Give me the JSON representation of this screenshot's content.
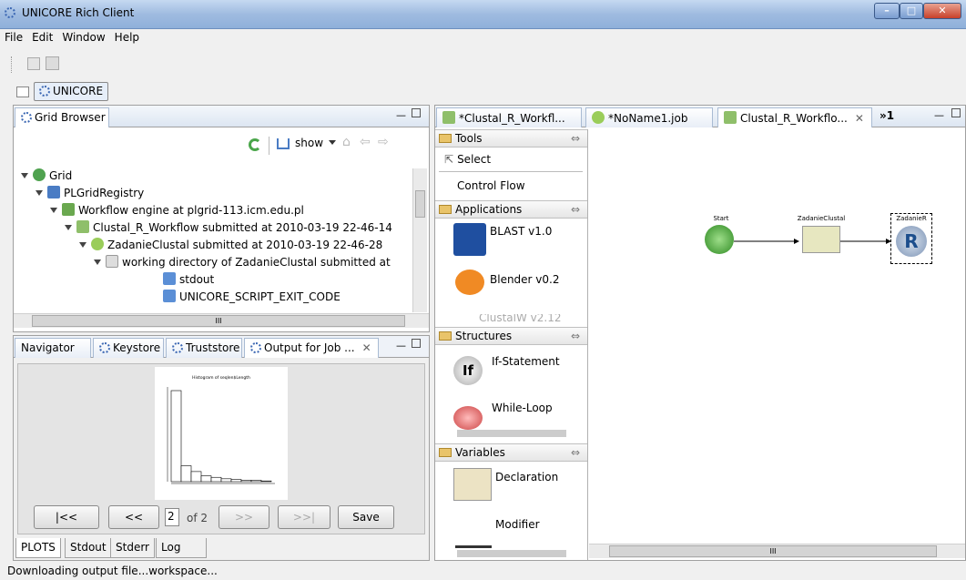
{
  "window": {
    "title": "UNICORE Rich Client"
  },
  "menu": [
    "File",
    "Edit",
    "Window",
    "Help"
  ],
  "perspective": {
    "label": "UNICORE"
  },
  "grid_browser": {
    "tab": "Grid Browser",
    "show_label": "show",
    "tree": [
      {
        "label": "Grid",
        "indent": 0,
        "icon": "globe-icon"
      },
      {
        "label": "PLGridRegistry",
        "indent": 1,
        "icon": "registry-icon"
      },
      {
        "label": "Workflow engine at plgrid-113.icm.edu.pl",
        "indent": 2,
        "icon": "workflow-engine-icon"
      },
      {
        "label": "Clustal_R_Workflow submitted at 2010-03-19 22-46-14",
        "indent": 3,
        "icon": "workflow-icon"
      },
      {
        "label": "ZadanieClustal submitted at 2010-03-19 22-46-28",
        "indent": 4,
        "icon": "job-icon"
      },
      {
        "label": "working directory of ZadanieClustal submitted at",
        "indent": 5,
        "icon": "folder-icon"
      },
      {
        "label": "stdout",
        "indent": 6,
        "icon": "file-icon"
      },
      {
        "label": "UNICORE_SCRIPT_EXIT_CODE",
        "indent": 6,
        "icon": "file-icon"
      }
    ],
    "hscroll_mark": "III"
  },
  "views": {
    "tabs": [
      "Navigator",
      "Keystore",
      "Truststore",
      "Output for Job ..."
    ]
  },
  "output": {
    "plot_title": "Histogram of seqlen$Length",
    "page_value": "2",
    "page_of": "of 2",
    "buttons": {
      "first": "|<<",
      "prev": "<<",
      "next": ">>",
      "last": ">>|",
      "save": "Save"
    },
    "bottom_tabs": [
      "PLOTS",
      "Stdout",
      "Stderr",
      "Log"
    ],
    "histogram": [
      6.3,
      1.1,
      0.7,
      0.4,
      0.3,
      0.2,
      0.15,
      0.1,
      0.1,
      0.05
    ]
  },
  "editor": {
    "tabs": [
      "*Clustal_R_Workfl...",
      "*NoName1.job",
      "Clustal_R_Workflo...",
      "»1"
    ]
  },
  "palette": {
    "tools": "Tools",
    "select": "Select",
    "control_flow": "Control Flow",
    "applications": "Applications",
    "apps": [
      "BLAST v1.0",
      "Blender v0.2",
      "ClustalW v2.12"
    ],
    "structures": "Structures",
    "structs": [
      "If-Statement",
      "While-Loop"
    ],
    "variables": "Variables",
    "vars": [
      "Declaration",
      "Modifier"
    ]
  },
  "canvas": {
    "nodes": [
      "Start",
      "ZadanieClustal",
      "ZadanieR"
    ],
    "hscroll_mark": "III"
  },
  "status": {
    "text": "Downloading output file...workspace..."
  }
}
